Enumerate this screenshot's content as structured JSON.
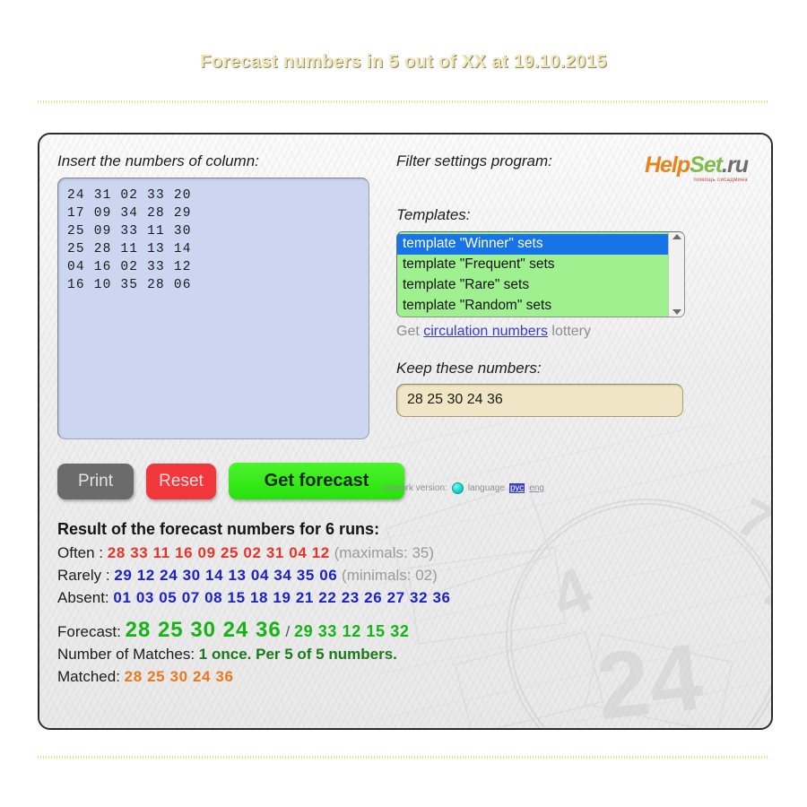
{
  "page": {
    "title": "Forecast numbers in 5 out of XX at 19.10.2015"
  },
  "left_panel": {
    "insert_label": "Insert the numbers of column:",
    "textarea_value": "24 31 02 33 20\n17 09 34 28 29\n25 09 33 11 30\n25 28 11 13 14\n04 16 02 33 12\n16 10 35 28 06",
    "buttons": {
      "print": "Print",
      "reset": "Reset",
      "get_forecast": "Get forecast"
    }
  },
  "network_line": {
    "network_version_label": "network version:",
    "status_icon": "status-dot-icon",
    "language_label": "language",
    "lang_rus": "рус",
    "lang_eng": "eng"
  },
  "right_panel": {
    "filter_label": "Filter settings program:",
    "logo": {
      "help": "Help",
      "set": "Set",
      "ru": ".ru",
      "sub": "помощь сисадмина"
    },
    "templates_label": "Templates:",
    "templates": [
      {
        "label": "template \"Winner\" sets",
        "selected": true
      },
      {
        "label": "template \"Frequent\" sets",
        "selected": false
      },
      {
        "label": "template \"Rare\" sets",
        "selected": false
      },
      {
        "label": "template \"Random\" sets",
        "selected": false
      }
    ],
    "circulation": {
      "prefix": "Get ",
      "link": "circulation numbers",
      "suffix": " lottery"
    },
    "keep_label": "Keep these numbers:",
    "keep_value": "28 25 30 24 36"
  },
  "results": {
    "heading": "Result of the forecast numbers for 6 runs:",
    "often": {
      "label": "Often :",
      "numbers": "28 33 11 16 09 25 02 31 04 12",
      "note": "(maximals: 35)"
    },
    "rarely": {
      "label": "Rarely :",
      "numbers": "29 12 24 30 14 13 04 34 35 06",
      "note": "(minimals: 02)"
    },
    "absent": {
      "label": "Absent:",
      "numbers": "01 03 05 07 08 15 18 19 21 22 23 26 27 32 36"
    },
    "forecast": {
      "label": "Forecast:",
      "primary": "28 25 30 24 36",
      "separator": "/",
      "secondary": "29 33 12 15 32"
    },
    "matches": {
      "label": "Number of Matches:",
      "value": "1 once. Per 5 of 5 numbers."
    },
    "matched": {
      "label": "Matched:",
      "numbers": "28 25 30 24 36"
    }
  },
  "colors": {
    "accent_green": "#36ea18",
    "reset_red": "#f1363c",
    "print_gray": "#6b6b6b",
    "often_red": "#e8332a",
    "rarely_blue": "#1d21c8",
    "forecast_green": "#17b317",
    "matched_orange": "#e8791f",
    "selected_blue": "#1673e8",
    "title_gold": "#efe7b8"
  }
}
